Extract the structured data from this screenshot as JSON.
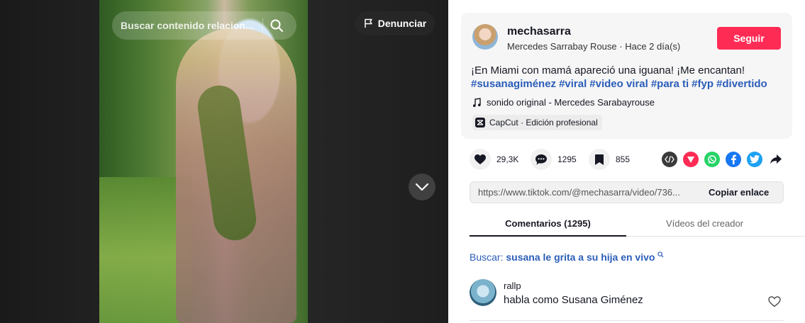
{
  "video": {
    "search_placeholder": "Buscar contenido relacion...",
    "report_label": "Denunciar"
  },
  "author": {
    "username": "mechasarra",
    "display_name": "Mercedes Sarrabay Rouse",
    "posted": "Hace 2 día(s)",
    "meta_separator": " · ",
    "follow_label": "Seguir"
  },
  "caption": {
    "text": "¡En Miami con mamá apareció una iguana! ¡Me encantan!",
    "hashtags": [
      "#susanagiménez",
      "#viral",
      "#video viral",
      "#para ti",
      "#fyp",
      "#divertido"
    ]
  },
  "music": {
    "label": "sonido original - Mercedes Sarabayrouse"
  },
  "capcut": {
    "label": "CapCut · Edición profesional"
  },
  "stats": {
    "likes": "29,3K",
    "comments": "1295",
    "saves": "855"
  },
  "share_icons": [
    "embed-icon",
    "tiktok-send-icon",
    "whatsapp-icon",
    "facebook-icon",
    "twitter-icon",
    "share-arrow-icon"
  ],
  "link": {
    "url": "https://www.tiktok.com/@mechasarra/video/736...",
    "copy_label": "Copiar enlace"
  },
  "tabs": {
    "comments": "Comentarios (1295)",
    "creator_videos": "Vídeos del creador"
  },
  "search_suggestion": {
    "label": "Buscar:",
    "term": "susana le grita a su hija en vivo"
  },
  "comment": {
    "user": "rallp",
    "text": "habla como Susana Giménez"
  },
  "colors": {
    "accent": "#fe2c55",
    "hashtag": "#2b5db9",
    "whatsapp": "#25d366",
    "facebook": "#1877f2",
    "twitter": "#1da1f2",
    "send": "#fe2c55"
  }
}
